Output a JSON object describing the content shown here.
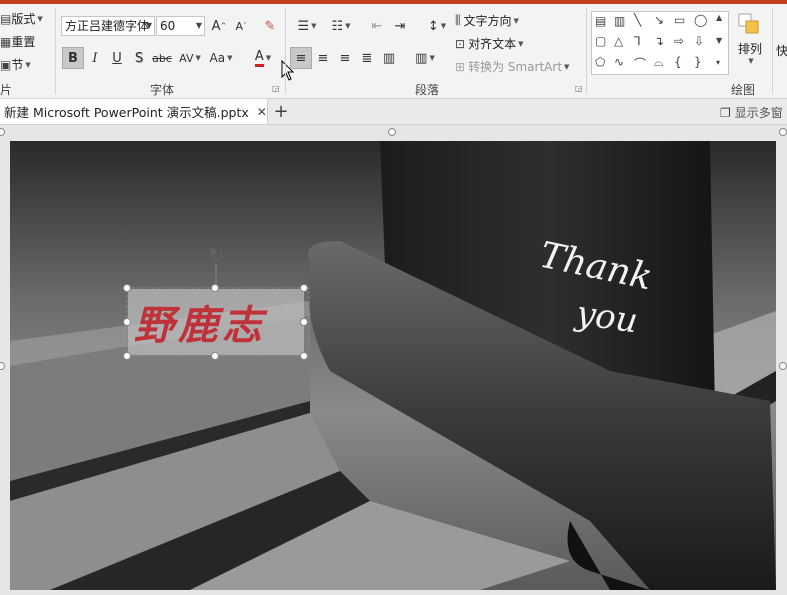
{
  "ribbon": {
    "left_column": {
      "layout_label": "版式",
      "reset_label": "重置",
      "section_label": "节"
    },
    "font": {
      "font_name": "方正吕建德字体",
      "font_size": "60",
      "group_label": "字体",
      "bold": "B",
      "italic": "I",
      "underline": "U",
      "shadow": "S",
      "strike": "abc",
      "spacing": "AV",
      "change_case": "Aa",
      "font_color": "A",
      "grow": "A",
      "shrink": "A",
      "font_color_hex": "#d02020"
    },
    "paragraph": {
      "group_label": "段落",
      "text_direction_label": "文字方向",
      "align_text_label": "对齐文本",
      "smartart_label": "转换为 SmartArt"
    },
    "drawing": {
      "group_label": "绘图",
      "arrange_label": "排列",
      "quick_label": "快"
    },
    "left_cut_label": "片"
  },
  "tabs": {
    "doc_title": "新建 Microsoft PowerPoint 演示文稿.pptx",
    "close_glyph": "✕",
    "add_glyph": "+",
    "show_windows_label": "显示多窗"
  },
  "slide": {
    "textbox_text": "野鹿志",
    "chalk_line1": "Thank",
    "chalk_line2": "you",
    "text_color": "#c0323a"
  },
  "colors": {
    "accent": "#c43e1c",
    "ribbon_bg": "#f3f3f3"
  }
}
